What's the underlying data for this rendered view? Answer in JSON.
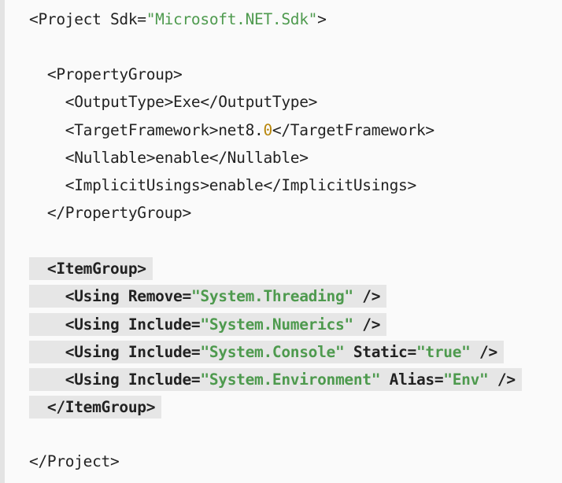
{
  "code": {
    "project_open": {
      "a": "<Project Sdk=",
      "b": "\"Microsoft.NET.Sdk\"",
      "c": ">"
    },
    "pg_open": "<PropertyGroup>",
    "output_type": "<OutputType>Exe</OutputType>",
    "tf": {
      "a": "<TargetFramework>net8.",
      "b": "0",
      "c": "</TargetFramework>"
    },
    "nullable": "<Nullable>enable</Nullable>",
    "implicit_usings": "<ImplicitUsings>enable</ImplicitUsings>",
    "pg_close": "</PropertyGroup>",
    "ig_open": "<ItemGroup>",
    "using1": {
      "a": "<Using Remove=",
      "b": "\"System.Threading\"",
      "c": " />"
    },
    "using2": {
      "a": "<Using Include=",
      "b": "\"System.Numerics\"",
      "c": " />"
    },
    "using3": {
      "a": "<Using Include=",
      "b": "\"System.Console\"",
      "c": " Static=",
      "d": "\"true\"",
      "e": " />"
    },
    "using4": {
      "a": "<Using Include=",
      "b": "\"System.Environment\"",
      "c": " Alias=",
      "d": "\"Env\"",
      "e": " />"
    },
    "ig_close": "</ItemGroup>",
    "project_close": "</Project>"
  },
  "colors": {
    "string": "#4e9a4e",
    "number": "#b8860b",
    "highlight": "#e6e6e6",
    "text": "#222222"
  }
}
